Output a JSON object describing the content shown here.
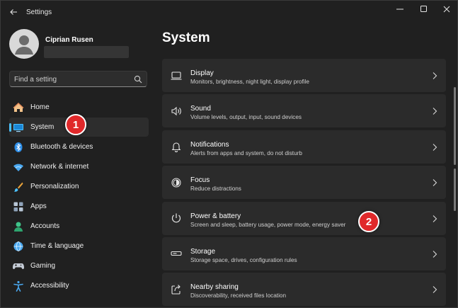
{
  "window": {
    "title": "Settings"
  },
  "profile": {
    "name": "Ciprian Rusen"
  },
  "search": {
    "placeholder": "Find a setting"
  },
  "sidebar": {
    "items": [
      {
        "label": "Home",
        "icon": "home-icon"
      },
      {
        "label": "System",
        "icon": "system-icon",
        "selected": true
      },
      {
        "label": "Bluetooth & devices",
        "icon": "bluetooth-icon"
      },
      {
        "label": "Network & internet",
        "icon": "wifi-icon"
      },
      {
        "label": "Personalization",
        "icon": "brush-icon"
      },
      {
        "label": "Apps",
        "icon": "apps-icon"
      },
      {
        "label": "Accounts",
        "icon": "accounts-icon"
      },
      {
        "label": "Time & language",
        "icon": "globe-icon"
      },
      {
        "label": "Gaming",
        "icon": "gamepad-icon"
      },
      {
        "label": "Accessibility",
        "icon": "accessibility-icon"
      }
    ]
  },
  "main": {
    "title": "System",
    "cards": [
      {
        "title": "Display",
        "desc": "Monitors, brightness, night light, display profile",
        "icon": "display-icon"
      },
      {
        "title": "Sound",
        "desc": "Volume levels, output, input, sound devices",
        "icon": "sound-icon"
      },
      {
        "title": "Notifications",
        "desc": "Alerts from apps and system, do not disturb",
        "icon": "bell-icon"
      },
      {
        "title": "Focus",
        "desc": "Reduce distractions",
        "icon": "focus-icon"
      },
      {
        "title": "Power & battery",
        "desc": "Screen and sleep, battery usage, power mode, energy saver",
        "icon": "power-icon"
      },
      {
        "title": "Storage",
        "desc": "Storage space, drives, configuration rules",
        "icon": "storage-icon"
      },
      {
        "title": "Nearby sharing",
        "desc": "Discoverability, received files location",
        "icon": "share-icon"
      }
    ]
  },
  "badges": {
    "one": "1",
    "two": "2"
  },
  "colors": {
    "accent": "#4cc2ff",
    "badge": "#e0282a",
    "background": "#202020",
    "card": "#2b2b2b"
  }
}
